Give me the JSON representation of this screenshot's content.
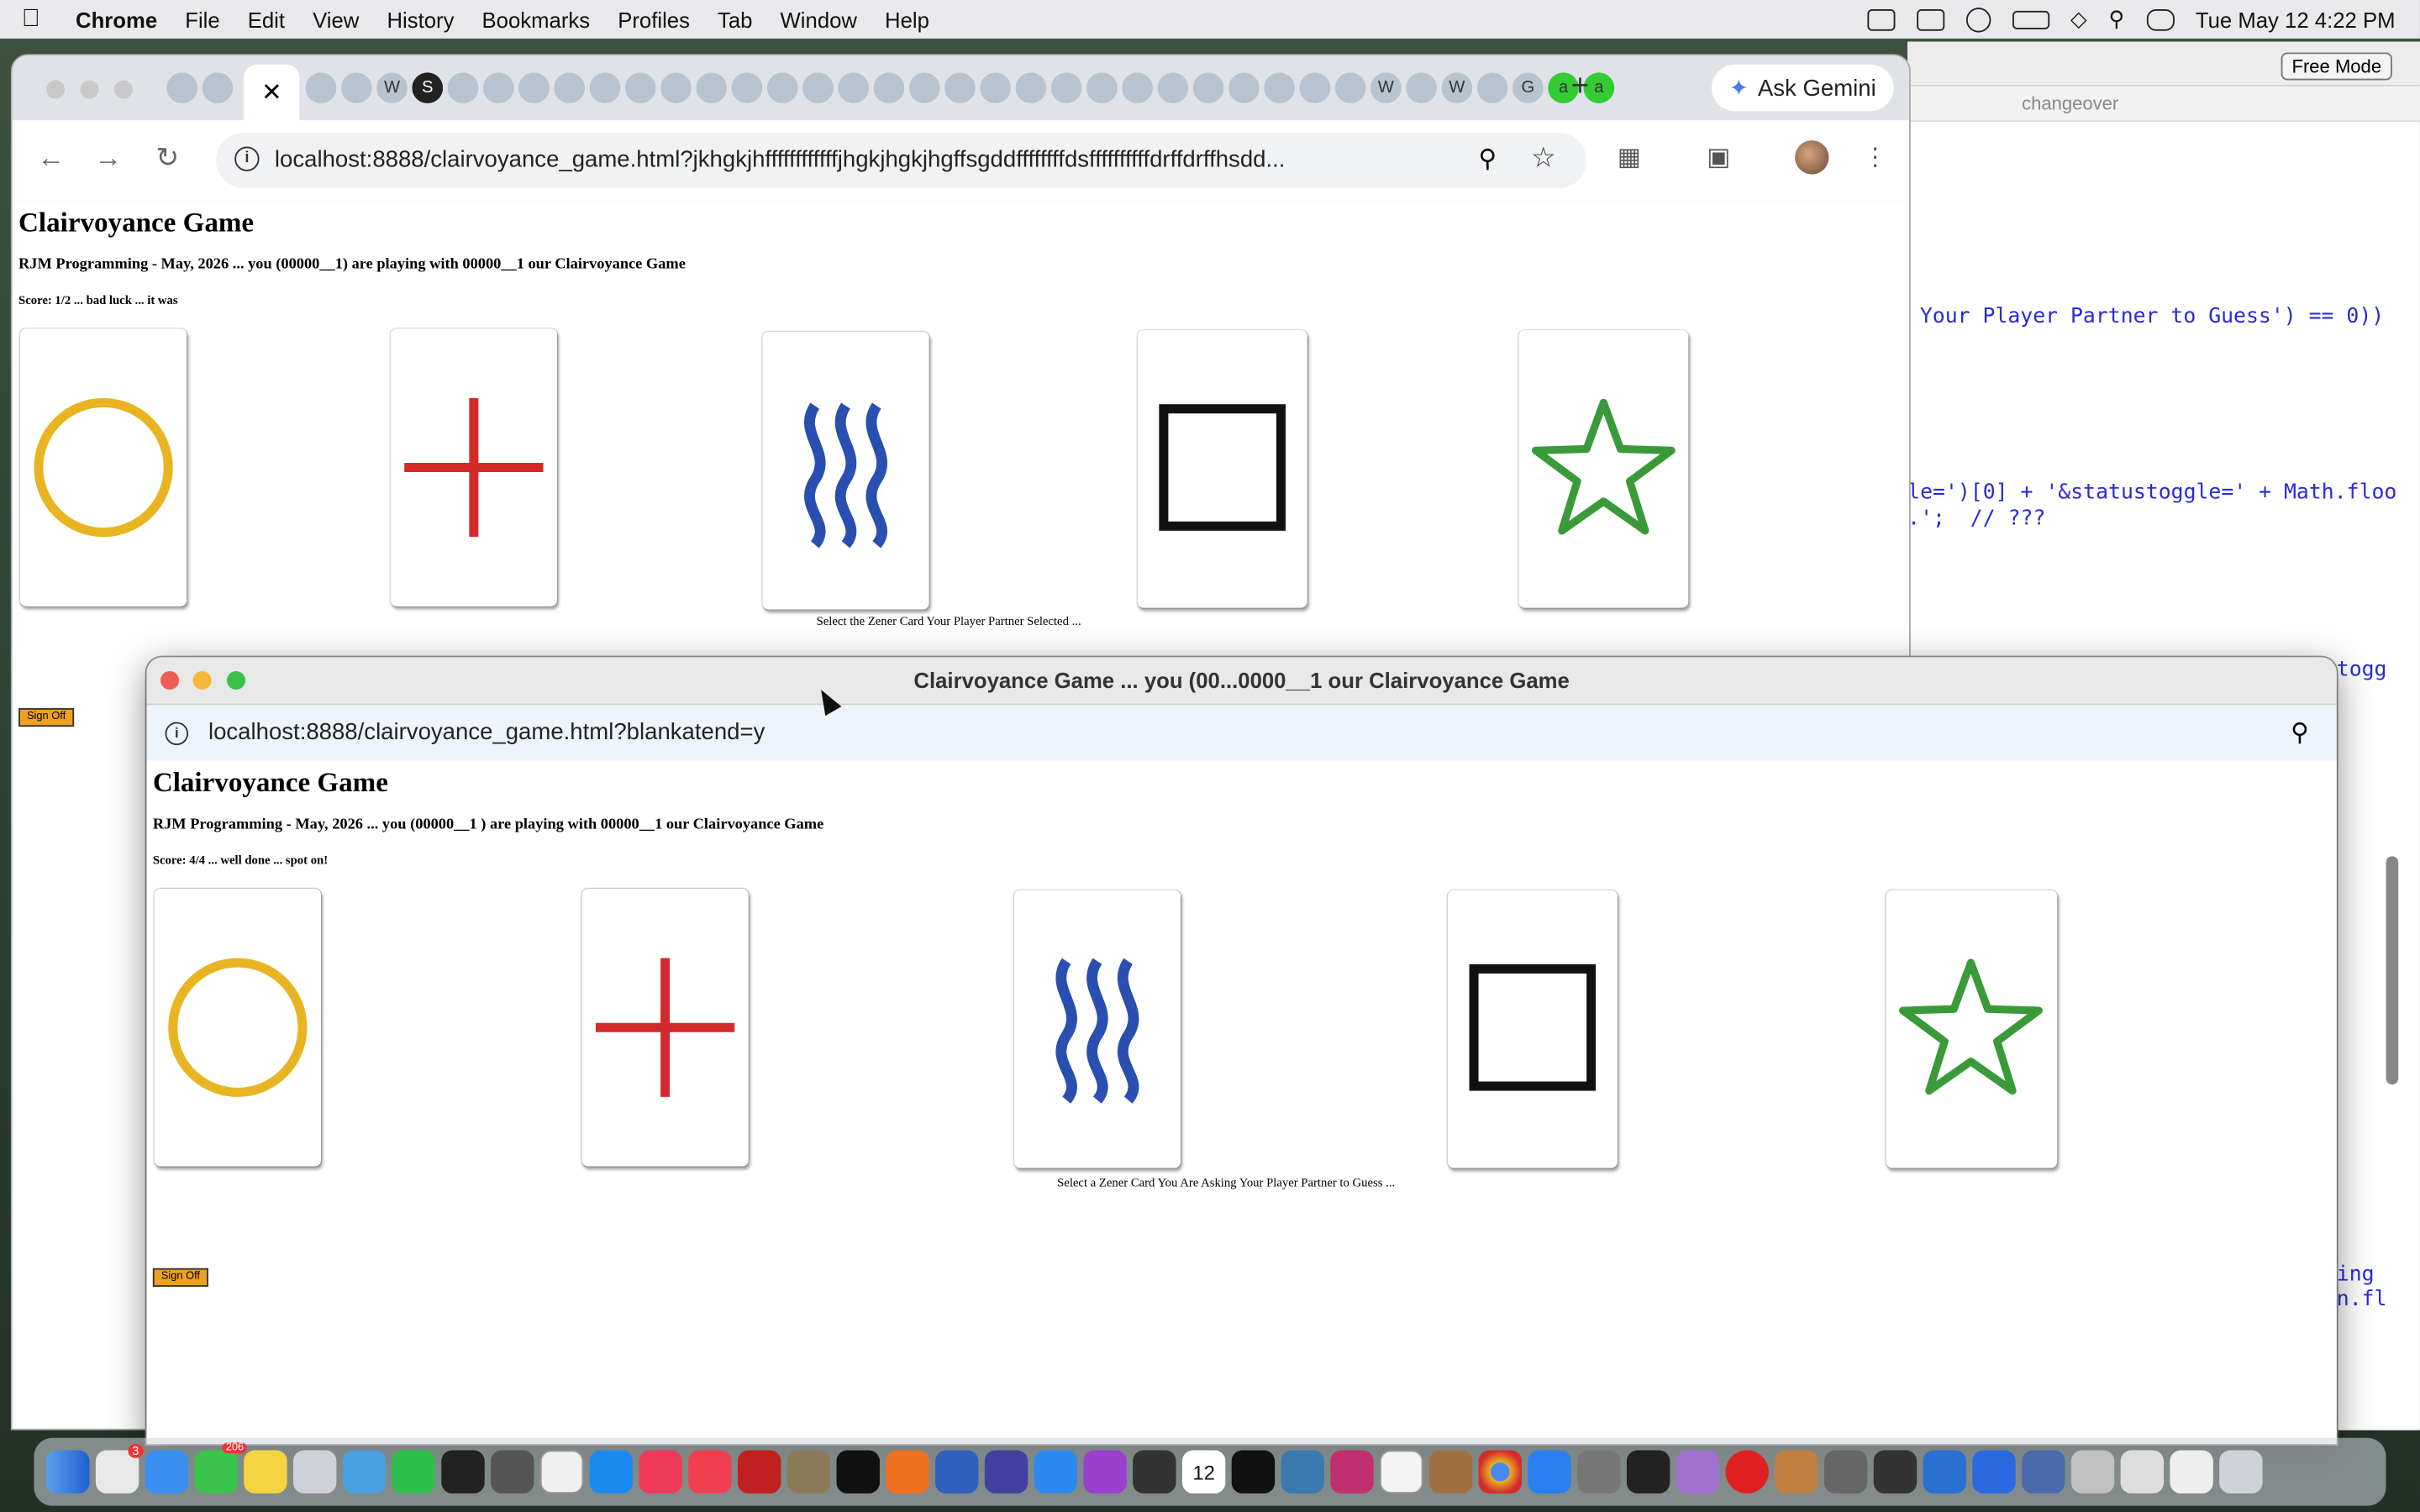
{
  "menubar": {
    "app": "Chrome",
    "items": [
      "File",
      "Edit",
      "View",
      "History",
      "Bookmarks",
      "Profiles",
      "Tab",
      "Window",
      "Help"
    ],
    "clock": "Tue May 12  4:22 PM"
  },
  "editor": {
    "free_mode": "Free Mode",
    "branch": "changeover",
    "lines": [
      "Your Player Partner to Guess') == 0))",
      "le=')[0] + '&statustoggle=' + Math.floo",
      ".';  // ???",
      "togg",
      "ing",
      "n.fl"
    ]
  },
  "main_window": {
    "gemini": "Ask Gemini",
    "url": "localhost:8888/clairvoyance_game.html?jkhgkjhffffffffffffjhgkjhgkjhgffsgddffffffffdsffffffffffdrffdrffhsdd...",
    "page": {
      "title": "Clairvoyance Game",
      "subtitle": "RJM Programming - May, 2026 ... you (00000__1) are playing with 00000__1 our Clairvoyance Game",
      "score": "Score: 1/2 ... bad luck ... it was",
      "prompt": "Select the Zener Card Your Player Partner Selected ...",
      "sign_off": "Sign Off"
    }
  },
  "popup": {
    "window_title": "Clairvoyance Game ... you (00...0000__1 our Clairvoyance Game",
    "url": "localhost:8888/clairvoyance_game.html?blankatend=y",
    "page": {
      "title": "Clairvoyance Game",
      "subtitle": "RJM Programming - May, 2026 ... you (00000__1 ) are playing with 00000__1 our Clairvoyance Game",
      "score": "Score: 4/4 ... well done ... spot on!",
      "prompt": "Select a Zener Card You Are Asking Your Player Partner to Guess ...",
      "sign_off": "Sign Off"
    }
  },
  "cards": [
    {
      "symbol": "circle",
      "color": "#e8b422"
    },
    {
      "symbol": "cross",
      "color": "#d42a2a"
    },
    {
      "symbol": "waves",
      "color": "#2a4fb0"
    },
    {
      "symbol": "square",
      "color": "#111111"
    },
    {
      "symbol": "star",
      "color": "#3a9a3a"
    }
  ],
  "dock": {
    "calendar_day": "12",
    "badge_messages": "206",
    "badge_contacts": "3"
  }
}
